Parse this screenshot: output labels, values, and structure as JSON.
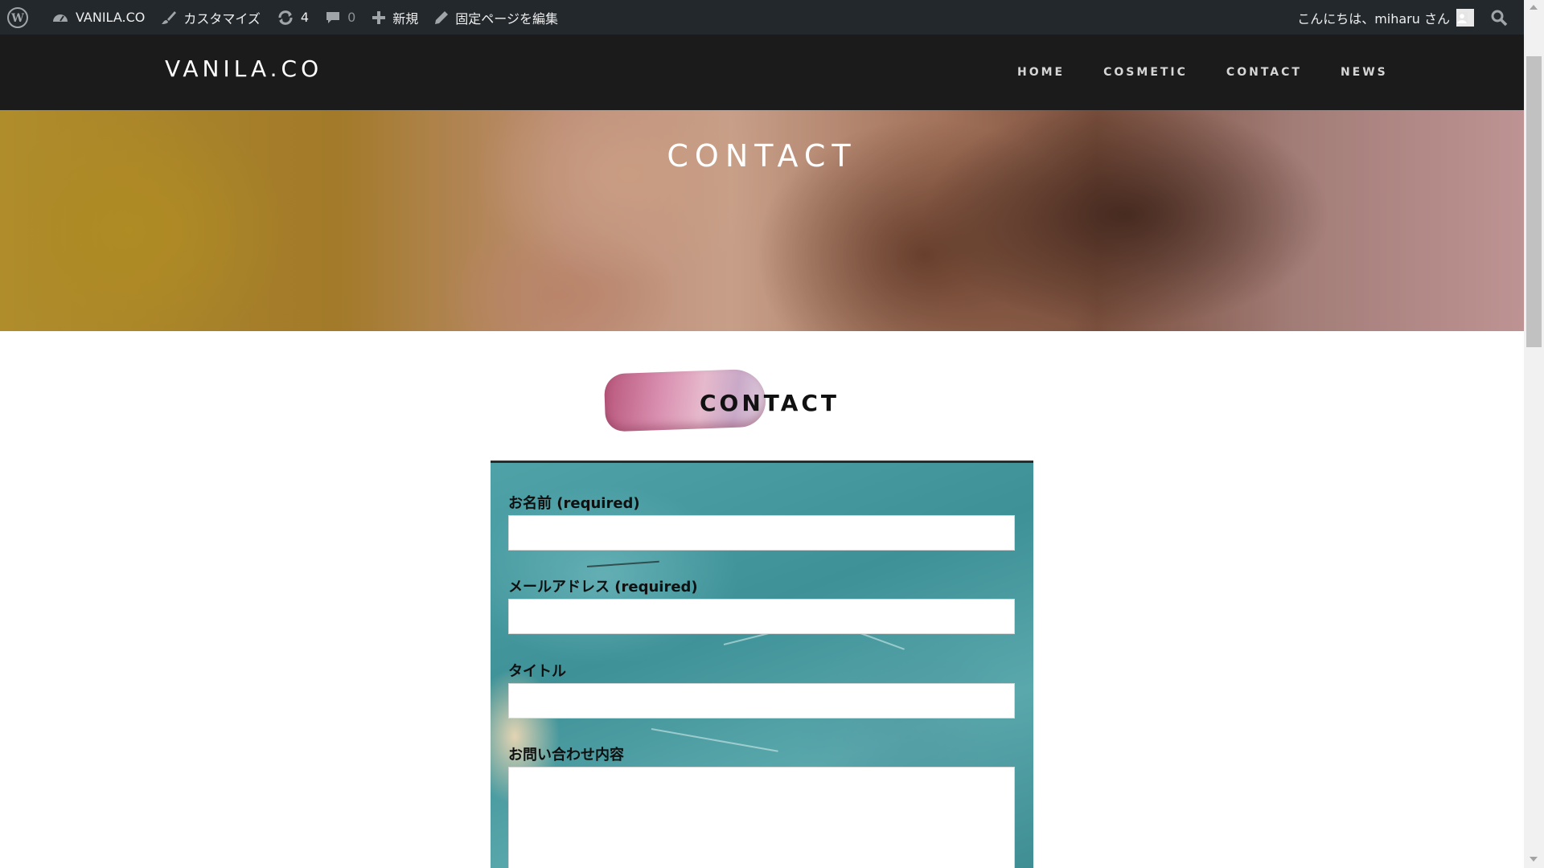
{
  "adminbar": {
    "site_name": "VANILA.CO",
    "customize": "カスタマイズ",
    "updates_count": "4",
    "comments_count": "0",
    "new": "新規",
    "edit_page": "固定ページを編集",
    "greeting": "こんにちは、miharu さん"
  },
  "header": {
    "site_title": "VANILA.CO",
    "nav": [
      "HOME",
      "COSMETIC",
      "CONTACT",
      "NEWS"
    ]
  },
  "hero": {
    "title": "CONTACT"
  },
  "section": {
    "title": "CONTACT"
  },
  "form": {
    "name_label": "お名前 (required)",
    "email_label": "メールアドレス (required)",
    "subject_label": "タイトル",
    "message_label": "お問い合わせ内容",
    "name_value": "",
    "email_value": "",
    "subject_value": "",
    "message_value": ""
  },
  "colors": {
    "adminbar_bg": "#23282d",
    "header_bg": "#1b1b1b",
    "form_panel": "#4fa3a8",
    "brush": "#d98fb0"
  },
  "icons": [
    "wordpress-icon",
    "dashboard-icon",
    "brush-icon",
    "updates-icon",
    "comment-icon",
    "plus-icon",
    "pencil-icon",
    "user-avatar-icon",
    "search-icon"
  ]
}
